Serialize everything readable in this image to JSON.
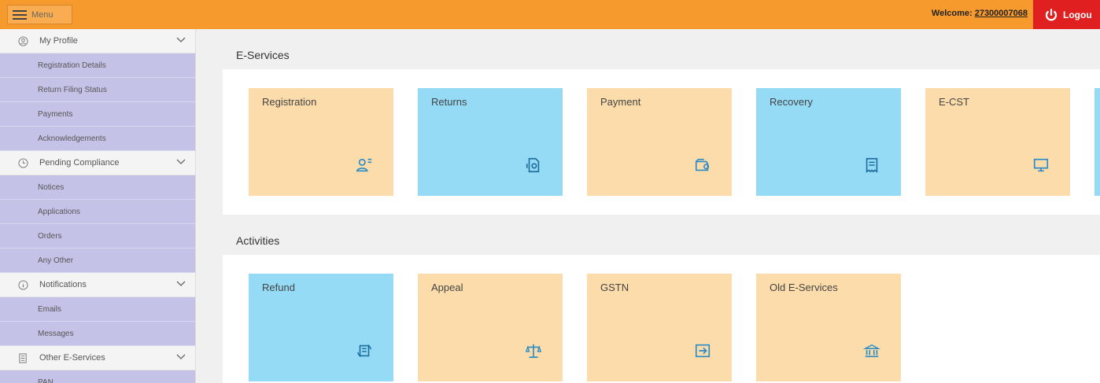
{
  "header": {
    "menu_label": "Menu",
    "welcome_prefix": "Welcome: ",
    "user_id": "27300007068",
    "logout_label": "Logou"
  },
  "sidebar": {
    "sections": [
      {
        "label": "My Profile",
        "icon": "user-circle-icon",
        "items": [
          "Registration Details",
          "Return Filing Status",
          "Payments",
          "Acknowledgements"
        ]
      },
      {
        "label": "Pending Compliance",
        "icon": "clock-icon",
        "items": [
          "Notices",
          "Applications",
          "Orders",
          "Any Other"
        ]
      },
      {
        "label": "Notifications",
        "icon": "info-icon",
        "items": [
          "Emails",
          "Messages"
        ]
      },
      {
        "label": "Other E-Services",
        "icon": "document-icon",
        "items": [
          "PAN"
        ]
      }
    ]
  },
  "main": {
    "eservices_heading": "E-Services",
    "activities_heading": "Activities",
    "eservices": [
      {
        "label": "Registration",
        "icon": "user-list-icon",
        "color": "#fcdcaa"
      },
      {
        "label": "Returns",
        "icon": "document-return-icon",
        "color": "#96dbf6"
      },
      {
        "label": "Payment",
        "icon": "wallet-icon",
        "color": "#fcdcaa"
      },
      {
        "label": "Recovery",
        "icon": "receipt-icon",
        "color": "#96dbf6"
      },
      {
        "label": "E-CST",
        "icon": "monitor-icon",
        "color": "#fcdcaa"
      }
    ],
    "activities": [
      {
        "label": "Refund",
        "icon": "refund-icon",
        "color": "#96dbf6"
      },
      {
        "label": "Appeal",
        "icon": "scales-icon",
        "color": "#fcdcaa"
      },
      {
        "label": "GSTN",
        "icon": "transfer-icon",
        "color": "#fcdcaa"
      },
      {
        "label": "Old E-Services",
        "icon": "bank-icon",
        "color": "#fcdcaa"
      }
    ]
  }
}
